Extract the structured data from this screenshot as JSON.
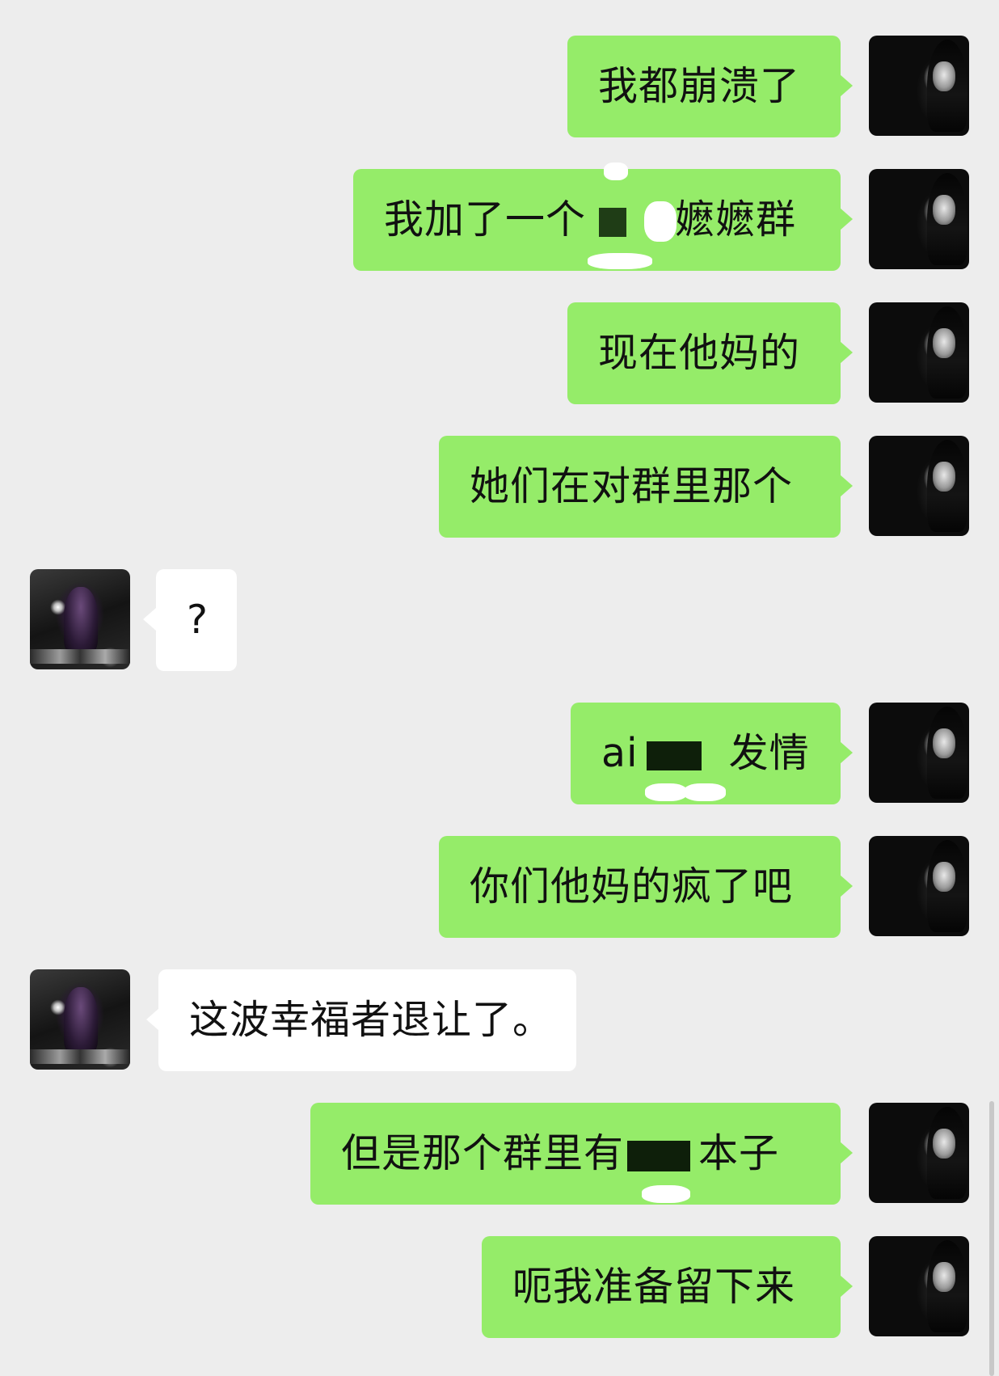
{
  "messages": [
    {
      "side": "right",
      "text": "我都崩溃了"
    },
    {
      "side": "right",
      "text_before": "我加了一个",
      "text_after": "嬷嬷群",
      "redacted": true
    },
    {
      "side": "right",
      "text": "现在他妈的"
    },
    {
      "side": "right",
      "text": "她们在对群里那个"
    },
    {
      "side": "left",
      "text": "?"
    },
    {
      "side": "right",
      "text_before": "ai",
      "text_after": "发情",
      "redacted": true
    },
    {
      "side": "right",
      "text": "你们他妈的疯了吧"
    },
    {
      "side": "left",
      "text": "这波幸福者退让了。"
    },
    {
      "side": "right",
      "text_before": "但是那个群里有",
      "text_after": "本子",
      "redacted": true
    },
    {
      "side": "right",
      "text": "呃我准备留下来"
    }
  ],
  "colors": {
    "background": "#ededed",
    "bubble_self": "#95ec69",
    "bubble_other": "#ffffff",
    "redaction": "#1f3d16"
  },
  "icons": {
    "self_avatar": "user-avatar-dark-portrait",
    "other_avatar": "user-avatar-gothic-illustration"
  }
}
